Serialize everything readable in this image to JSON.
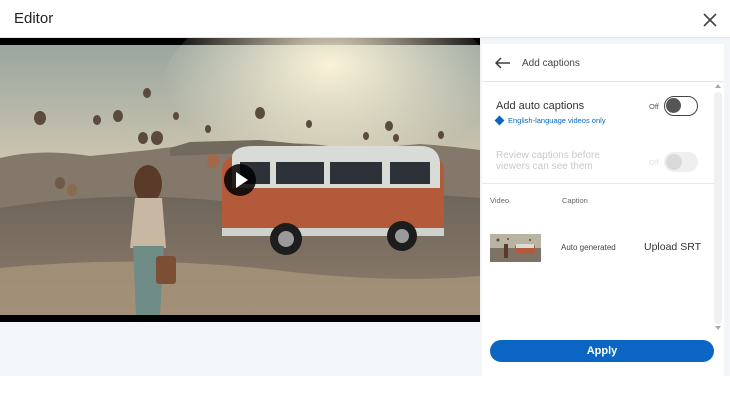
{
  "header": {
    "title": "Editor",
    "close_icon": "close-icon"
  },
  "video": {
    "play_icon": "play-icon"
  },
  "panel": {
    "back_icon": "arrow-left-icon",
    "title": "Add captions",
    "auto_captions": {
      "label": "Add auto captions",
      "state": "Off",
      "note": "English-language videos only",
      "note_icon": "info-diamond-icon"
    },
    "review_captions": {
      "label": "Review captions before viewers can see them",
      "state": "Off"
    },
    "columns": {
      "video": "Video",
      "caption": "Caption"
    },
    "caption_row": {
      "status": "Auto generated",
      "action": "Upload SRT"
    }
  },
  "footer": {
    "apply_label": "Apply"
  },
  "colors": {
    "accent": "#0a66c2",
    "panel_bg": "#ffffff",
    "editor_bg": "#f3f6f9"
  }
}
